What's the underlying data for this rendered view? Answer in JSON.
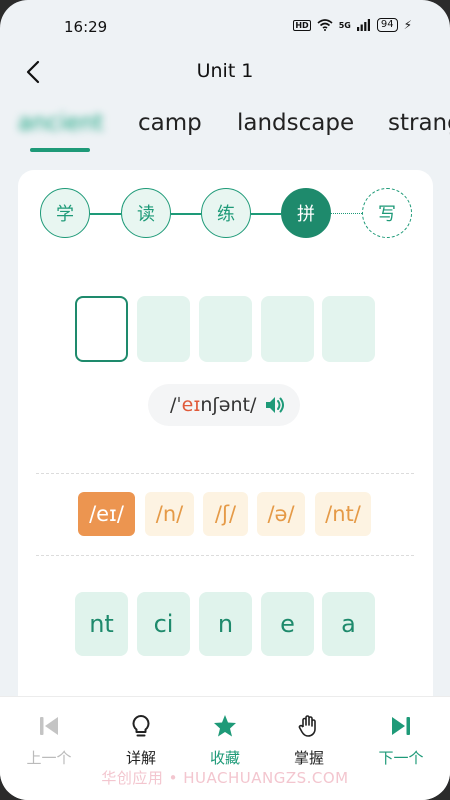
{
  "status_bar": {
    "time": "16:29",
    "hd": "HD",
    "network": "5G",
    "battery": "94"
  },
  "header": {
    "title": "Unit 1"
  },
  "tabs": [
    {
      "label": "ancient"
    },
    {
      "label": "camp"
    },
    {
      "label": "landscape"
    },
    {
      "label": "strang"
    }
  ],
  "steps": [
    {
      "label": "学",
      "state": "done"
    },
    {
      "label": "读",
      "state": "done"
    },
    {
      "label": "练",
      "state": "done"
    },
    {
      "label": "拼",
      "state": "active"
    },
    {
      "label": "写",
      "state": "future"
    }
  ],
  "answer_slots": 5,
  "phonetic": {
    "prefix": "/ˈ",
    "highlight": "eɪ",
    "rest": "nʃənt/"
  },
  "syllables": [
    {
      "text": "/eɪ/",
      "active": true
    },
    {
      "text": "/n/",
      "active": false
    },
    {
      "text": "/ʃ/",
      "active": false
    },
    {
      "text": "/ə/",
      "active": false
    },
    {
      "text": "/nt/",
      "active": false
    }
  ],
  "letters": [
    "nt",
    "ci",
    "n",
    "e",
    "a"
  ],
  "bottom_nav": {
    "prev": "上一个",
    "detail": "详解",
    "favorite": "收藏",
    "master": "掌握",
    "next": "下一个"
  },
  "watermark": "华创应用 • HUACHUANGZS.COM",
  "colors": {
    "accent": "#1e9a78",
    "accent_dark": "#1e8a6c",
    "orange": "#ec9550",
    "highlight": "#e05a3a"
  }
}
